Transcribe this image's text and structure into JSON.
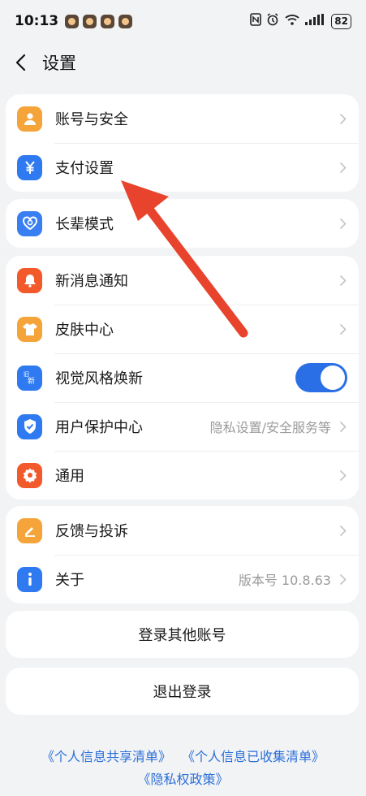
{
  "status_bar": {
    "time": "10:13",
    "battery": "82",
    "icons": [
      "nfc-icon",
      "alarm-icon",
      "wifi-icon",
      "signal-icon",
      "battery-icon"
    ]
  },
  "header": {
    "title": "设置"
  },
  "groups": [
    {
      "items": [
        {
          "label": "账号与安全",
          "icon": "user-icon",
          "color": "#f5a43a"
        },
        {
          "label": "支付设置",
          "icon": "yuan-icon",
          "color": "#2f7af0"
        }
      ]
    },
    {
      "items": [
        {
          "label": "长辈模式",
          "icon": "heart-icon",
          "color": "#3a7ff2"
        }
      ]
    },
    {
      "items": [
        {
          "label": "新消息通知",
          "icon": "bell-icon",
          "color": "#f25a2b"
        },
        {
          "label": "皮肤中心",
          "icon": "shirt-icon",
          "color": "#f5a43a"
        },
        {
          "label": "视觉风格焕新",
          "icon": "new-style-icon",
          "color": "#2f7af0",
          "toggle": true
        },
        {
          "label": "用户保护中心",
          "value": "隐私设置/安全服务等",
          "icon": "shield-icon",
          "color": "#2f7af0"
        },
        {
          "label": "通用",
          "icon": "gear-icon",
          "color": "#f25a2b"
        }
      ]
    },
    {
      "items": [
        {
          "label": "反馈与投诉",
          "icon": "edit-icon",
          "color": "#f5a43a"
        },
        {
          "label": "关于",
          "value": "版本号 10.8.63",
          "icon": "info-icon",
          "color": "#2f7af0"
        }
      ]
    }
  ],
  "buttons": {
    "switch_account": "登录其他账号",
    "logout": "退出登录"
  },
  "links": {
    "shared_info": "《个人信息共享清单》",
    "collected_info": "《个人信息已收集清单》",
    "privacy_policy": "《隐私权政策》"
  },
  "colors": {
    "accent": "#2b6fe6",
    "annotation_arrow": "#e8432c",
    "link": "#2c6fd8"
  }
}
